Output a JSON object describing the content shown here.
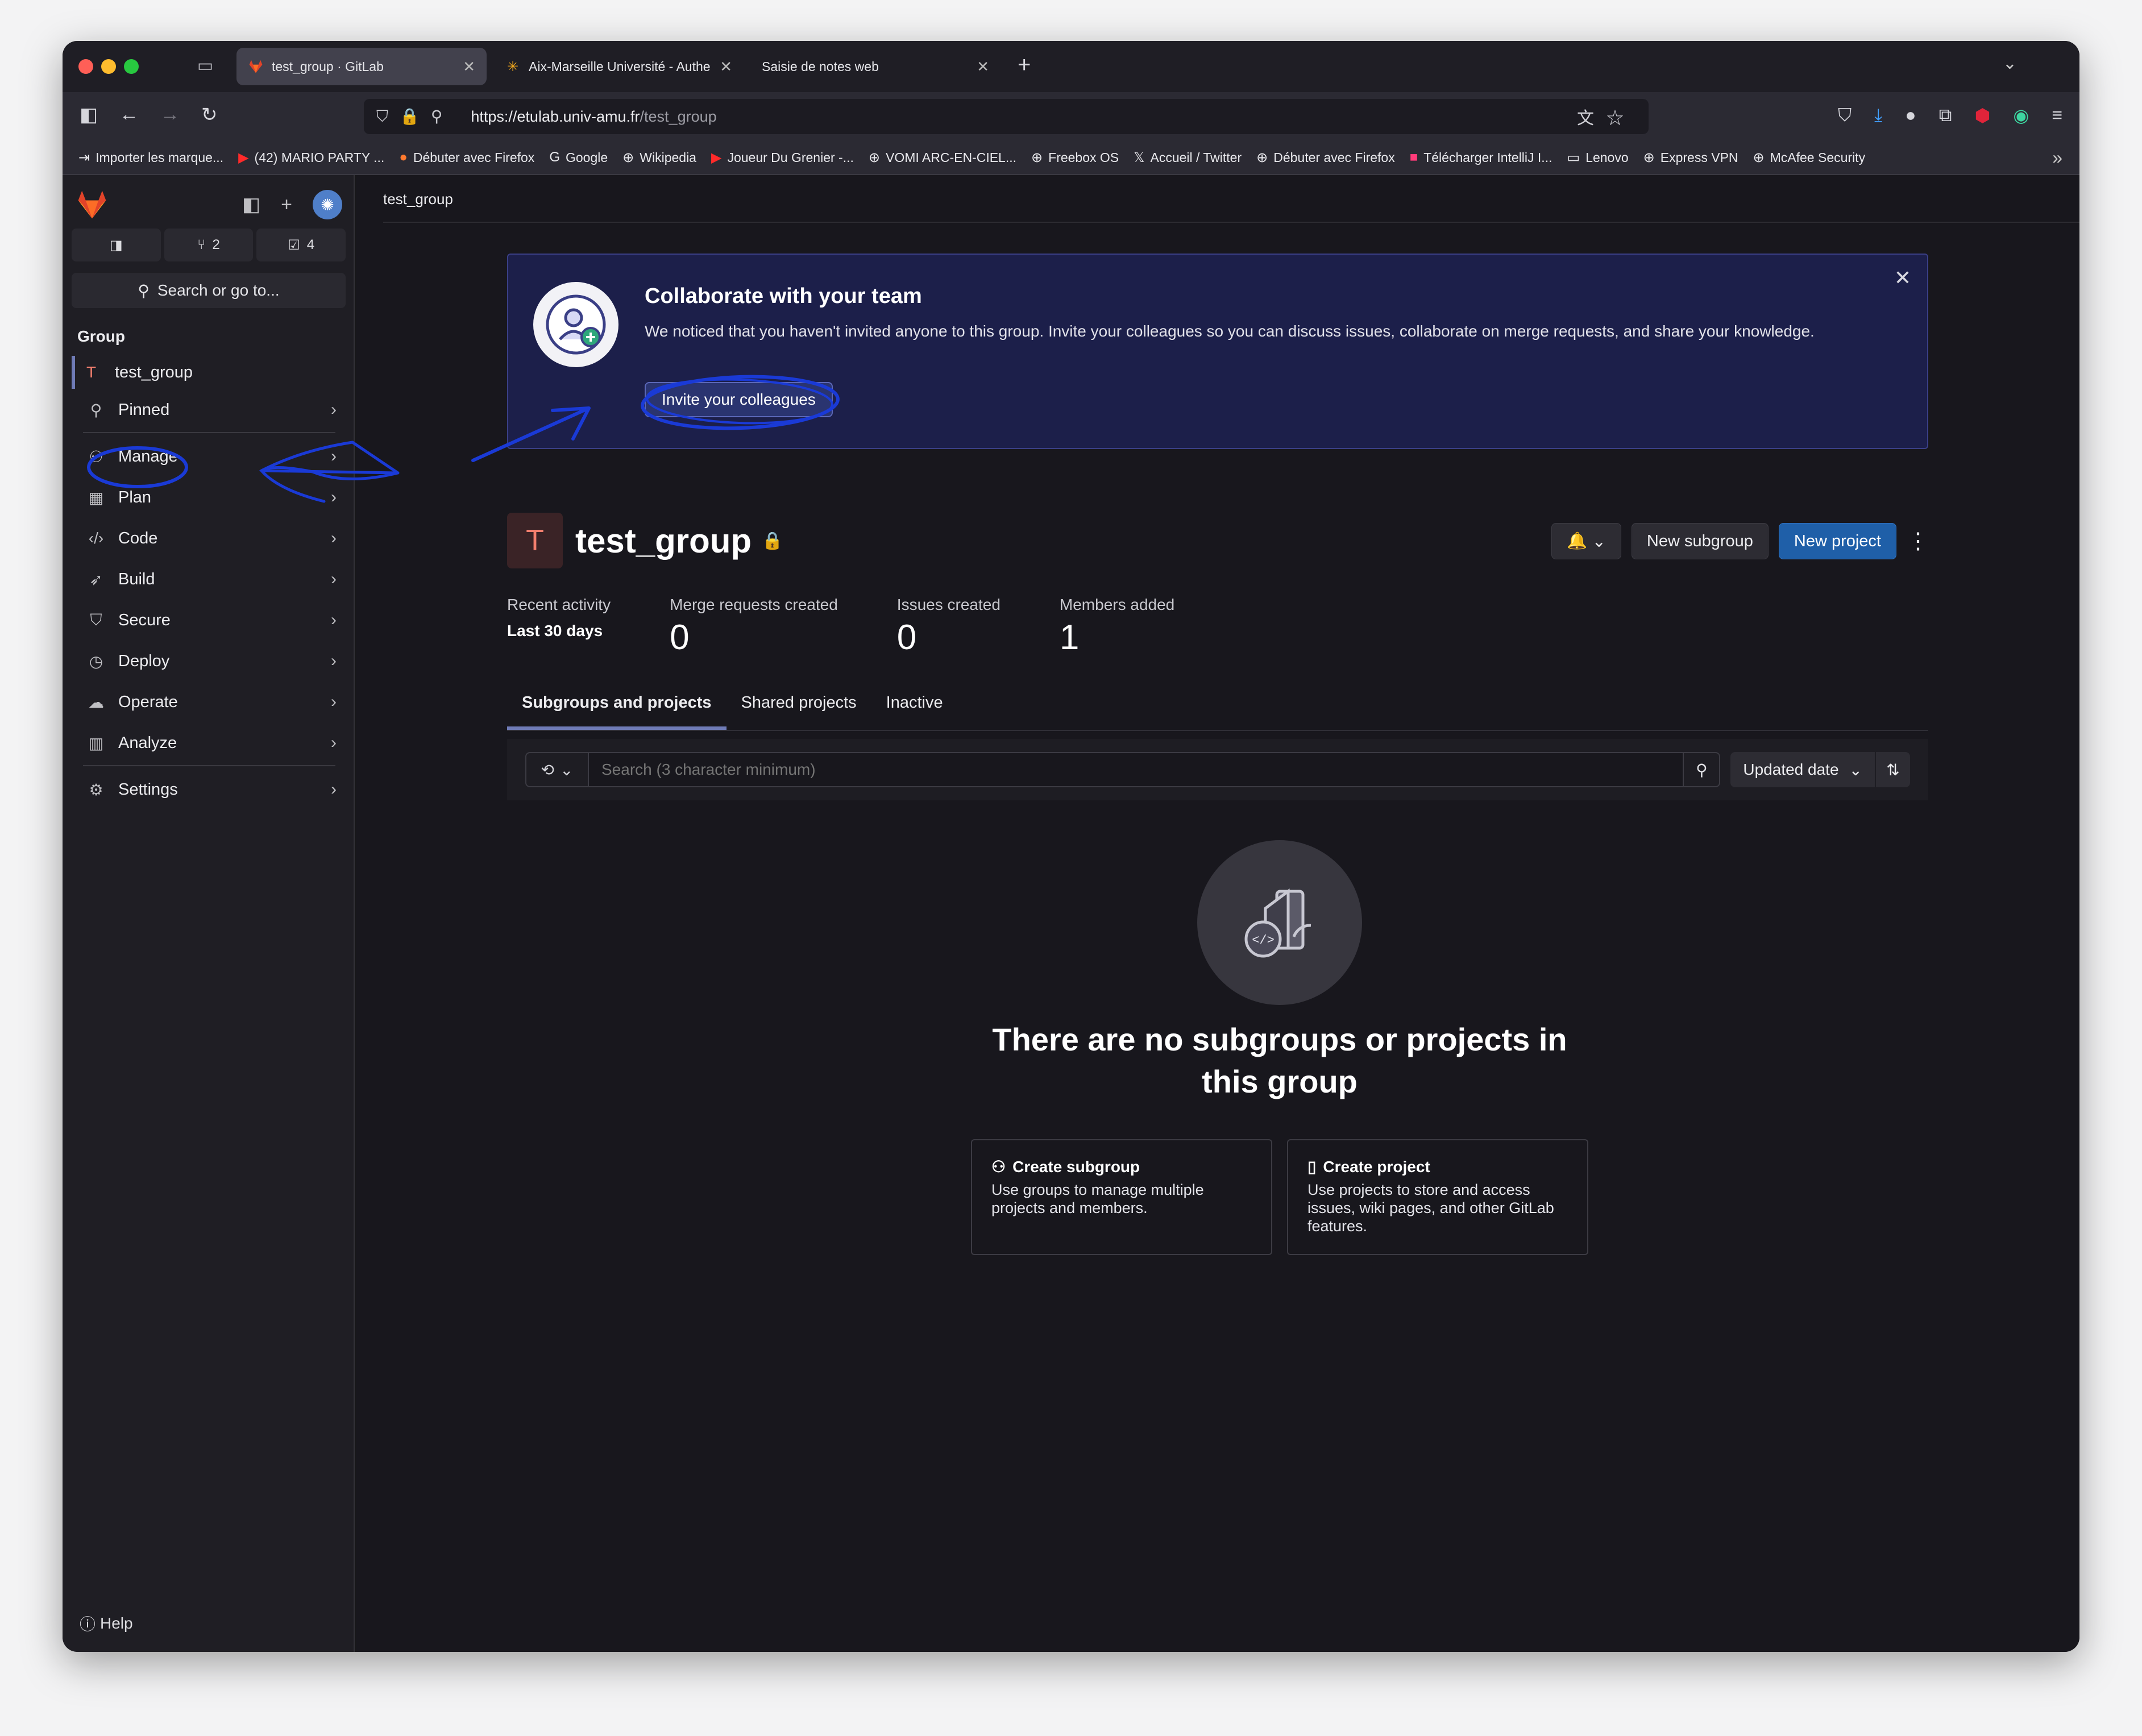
{
  "browser": {
    "tabs": [
      {
        "title": "test_group · GitLab",
        "active": true,
        "icon": "gitlab-icon"
      },
      {
        "title": "Aix-Marseille Université - Authe",
        "active": false,
        "icon": "amu-icon"
      },
      {
        "title": "Saisie de notes web",
        "active": false,
        "icon": "none"
      }
    ],
    "url_host": "https://etulab.univ-amu.fr",
    "url_path": "/test_group",
    "bookmarks": [
      {
        "label": "Importer les marque...",
        "icon": "import-icon"
      },
      {
        "label": "(42) MARIO PARTY ...",
        "icon": "youtube-icon"
      },
      {
        "label": "Débuter avec Firefox",
        "icon": "firefox-icon"
      },
      {
        "label": "Google",
        "icon": "google-icon"
      },
      {
        "label": "Wikipedia",
        "icon": "globe-icon"
      },
      {
        "label": "Joueur Du Grenier -...",
        "icon": "youtube-icon"
      },
      {
        "label": "VOMI ARC-EN-CIEL...",
        "icon": "globe-icon"
      },
      {
        "label": "Freebox OS",
        "icon": "globe-icon"
      },
      {
        "label": "Accueil / Twitter",
        "icon": "x-icon"
      },
      {
        "label": "Débuter avec Firefox",
        "icon": "globe-icon"
      },
      {
        "label": "Télécharger IntelliJ I...",
        "icon": "intellij-icon"
      },
      {
        "label": "Lenovo",
        "icon": "folder-icon"
      },
      {
        "label": "Express VPN",
        "icon": "globe-icon"
      },
      {
        "label": "McAfee Security",
        "icon": "globe-icon"
      }
    ]
  },
  "sidebar": {
    "counts": {
      "merge_requests": "2",
      "todos": "4"
    },
    "search_label": "Search or go to...",
    "section_label": "Group",
    "group_initial": "T",
    "group_name": "test_group",
    "items": [
      {
        "label": "Pinned",
        "icon": "pin-icon"
      },
      {
        "label": "Manage",
        "icon": "users-icon"
      },
      {
        "label": "Plan",
        "icon": "calendar-icon"
      },
      {
        "label": "Code",
        "icon": "code-icon"
      },
      {
        "label": "Build",
        "icon": "rocket-icon"
      },
      {
        "label": "Secure",
        "icon": "shield-icon"
      },
      {
        "label": "Deploy",
        "icon": "deploy-icon"
      },
      {
        "label": "Operate",
        "icon": "cloud-icon"
      },
      {
        "label": "Analyze",
        "icon": "chart-icon"
      },
      {
        "label": "Settings",
        "icon": "gear-icon"
      }
    ],
    "help_label": "Help"
  },
  "main": {
    "breadcrumb": "test_group",
    "banner": {
      "title": "Collaborate with your team",
      "text": "We noticed that you haven't invited anyone to this group. Invite your colleagues so you can discuss issues, collaborate on merge requests, and share your knowledge.",
      "button": "Invite your colleagues"
    },
    "group": {
      "initial": "T",
      "name": "test_group",
      "new_subgroup": "New subgroup",
      "new_project": "New project"
    },
    "stats": {
      "recent_label": "Recent activity",
      "period": "Last 30 days",
      "items": [
        {
          "label": "Merge requests created",
          "value": "0"
        },
        {
          "label": "Issues created",
          "value": "0"
        },
        {
          "label": "Members added",
          "value": "1"
        }
      ]
    },
    "tabs": [
      "Subgroups and projects",
      "Shared projects",
      "Inactive"
    ],
    "search_placeholder": "Search (3 character minimum)",
    "sort_label": "Updated date",
    "empty_title": "There are no subgroups or projects in this group",
    "cards": [
      {
        "title": "Create subgroup",
        "desc": "Use groups to manage multiple projects and members.",
        "icon": "subgroup-icon"
      },
      {
        "title": "Create project",
        "desc": "Use projects to store and access issues, wiki pages, and other GitLab features.",
        "icon": "project-icon"
      }
    ]
  },
  "colors": {
    "accent": "#1f5fa8",
    "annotation": "#1a3ad6",
    "banner_bg": "#1c1f4a"
  }
}
